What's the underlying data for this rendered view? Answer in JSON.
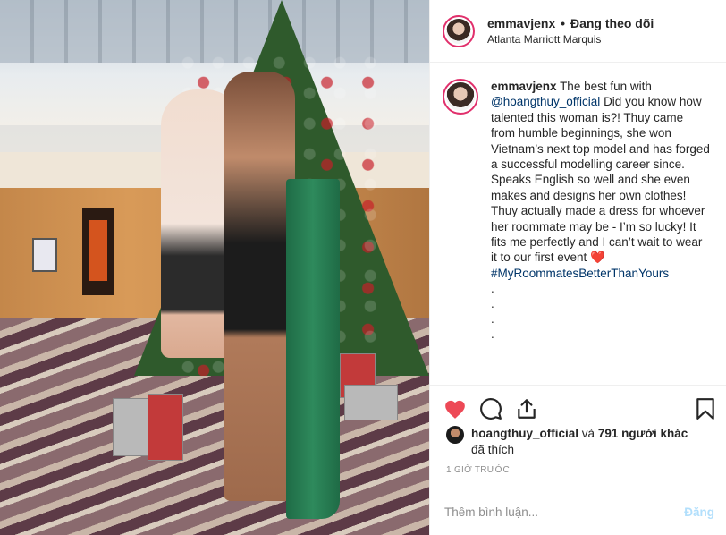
{
  "header": {
    "username": "emmavjenx",
    "separator": "•",
    "follow_status": "Đang theo dõi",
    "location": "Atlanta Marriott Marquis"
  },
  "caption": {
    "username": "emmavjenx",
    "intro": "The best fun with",
    "mention": "@hoangthuy_official",
    "body": "Did you know how talented this woman is?! Thuy came from humble beginnings, she won Vietnam’s next top model and has forged a successful modelling career since. Speaks English so well and she even makes and designs her own clothes! Thuy actually made a dress for whoever her roommate may be - I’m so lucky! It fits me perfectly and I can’t wait to wear it to our first event",
    "heart": "❤️",
    "hashtag": "#MyRoommatesBetterThanYours",
    "dots": [
      ".",
      ".",
      ".",
      "."
    ]
  },
  "likes": {
    "user": "hoangthuy_official",
    "conjunction": "và",
    "count_text": "791 người khác",
    "suffix": "đã thích"
  },
  "time_ago": "1 GIỜ TRƯỚC",
  "comment": {
    "placeholder": "Thêm bình luận...",
    "post_label": "Đăng"
  },
  "colors": {
    "like_active": "#ed4956",
    "link": "#003569",
    "post_disabled": "#b2dffc"
  },
  "icons": [
    "heart-filled-icon",
    "comment-icon",
    "share-icon",
    "bookmark-icon"
  ]
}
